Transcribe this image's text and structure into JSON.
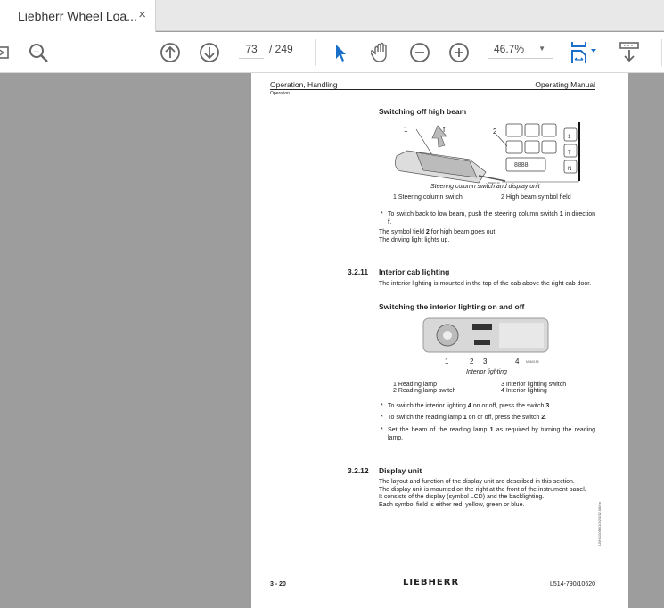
{
  "tab": {
    "title": "Liebherr Wheel Loa...",
    "close": "×"
  },
  "toolbar": {
    "current_page": "73",
    "total_pages": "/ 249",
    "zoom": "46.7%"
  },
  "page": {
    "header_left": "Operation, Handling",
    "header_right": "Operating Manual",
    "subheader": "Operation",
    "s1_title": "Switching off high beam",
    "fig1": {
      "label1": "1",
      "label2": "2",
      "label_f": "f",
      "code": "B6000310",
      "panel_btns": [
        "1",
        "T",
        "N"
      ]
    },
    "fig1_caption": "Steering column switch and display unit",
    "fig1_legend": [
      "1 Steering column switch",
      "2 High beam symbol field"
    ],
    "s1_bullet_a": "To switch back to low beam, push the steering column switch ",
    "s1_bullet_b": "1",
    "s1_bullet_c": " in direction ",
    "s1_bullet_d": "f",
    "s1_bullet_e": ".",
    "s1_p1a": "The symbol field ",
    "s1_p1b": "2",
    "s1_p1c": " for high beam goes out.",
    "s1_p2": "The driving light lights up.",
    "sec311_num": "3.2.11",
    "sec311_title": "Interior cab lighting",
    "sec311_p": "The interior lighting is mounted in the top of the cab above the right cab door.",
    "s2_title": "Switching the interior lighting on and off",
    "fig2": {
      "labels": [
        "1",
        "2",
        "3",
        "4"
      ],
      "code": "M660155"
    },
    "fig2_caption": "Interior lighting",
    "fig2_legend": [
      "1 Reading lamp",
      "2 Reading lamp switch",
      "3 Interior lighting switch",
      "4 Interior lighting"
    ],
    "b1": [
      "To switch the interior lighting ",
      "4",
      " on or off, press the switch ",
      "3",
      "."
    ],
    "b2": [
      "To switch the reading lamp ",
      "1",
      " on or off, press the switch ",
      "2",
      "."
    ],
    "b3": [
      "Set the beam of the reading lamp ",
      "1",
      " as required by turning the reading lamp."
    ],
    "sec312_num": "3.2.12",
    "sec312_title": "Display unit",
    "sec312_p": [
      "The layout and function of the display unit are described in this section.",
      "The display unit is mounted on the right at the front of the instrument panel.",
      "It consists of the display (symbol LCD) and the backlighting.",
      "Each symbol field is either red, yellow, green or blue."
    ],
    "side_code": "LBH/10068/10620/12.08/en",
    "footer_left": "3 - 20",
    "footer_logo": "LIEBHERR",
    "footer_right": "L514-790/10620"
  }
}
